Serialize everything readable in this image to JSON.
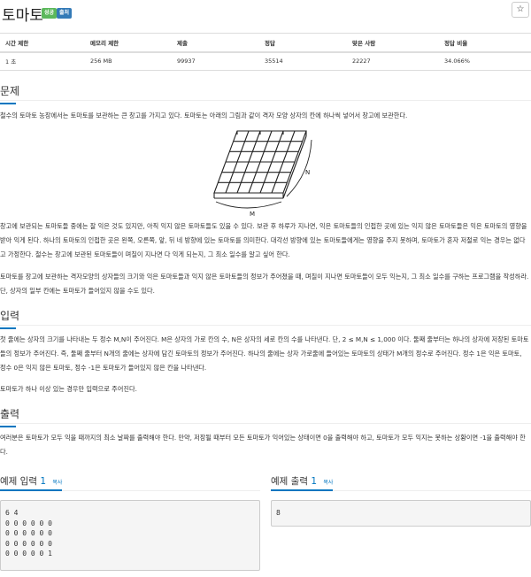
{
  "problem": {
    "title": "토마토",
    "badges": [
      "성공",
      "출처"
    ]
  },
  "header": {
    "star_icon": "star-icon"
  },
  "info_table": {
    "headers": [
      "시간 제한",
      "메모리 제한",
      "제출",
      "정답",
      "맞은 사람",
      "정답 비율"
    ],
    "row": [
      "1 초",
      "256 MB",
      "99937",
      "35514",
      "22227",
      "34.066%"
    ]
  },
  "sections": {
    "problem": {
      "title": "문제",
      "intro": "철수의 토마토 농장에서는 토마토를 보관하는 큰 창고를 가지고 있다. 토마토는 아래의 그림과 같이 격자 모양 상자의 칸에 하나씩 넣어서 창고에 보관한다.",
      "figure_labels": {
        "n": "N",
        "m": "M"
      },
      "body1": "창고에 보관되는 토마토들 중에는 잘 익은 것도 있지만, 아직 익지 않은 토마토들도 있을 수 있다. 보관 후 하루가 지나면, 익은 토마토들의 인접한 곳에 있는 익지 않은 토마토들은 익은 토마토의 영향을 받아 익게 된다. 하나의 토마토의 인접한 곳은 왼쪽, 오른쪽, 앞, 뒤 네 방향에 있는 토마토를 의미한다. 대각선 방향에 있는 토마토들에게는 영향을 주지 못하며, 토마토가 혼자 저절로 익는 경우는 없다고 가정한다. 철수는 창고에 보관된 토마토들이 며칠이 지나면 다 익게 되는지, 그 최소 일수를 알고 싶어 한다.",
      "body2": "토마토를 창고에 보관하는 격자모양의 상자들의 크기와 익은 토마토들과 익지 않은 토마토들의 정보가 주어졌을 때, 며칠이 지나면 토마토들이 모두 익는지, 그 최소 일수를 구하는 프로그램을 작성하라. 단, 상자의 일부 칸에는 토마토가 들어있지 않을 수도 있다."
    },
    "input": {
      "title": "입력",
      "body1": "첫 줄에는 상자의 크기를 나타내는 두 정수 M,N이 주어진다. M은 상자의 가로 칸의 수, N은 상자의 세로 칸의 수를 나타낸다. 단, 2 ≤ M,N ≤ 1,000 이다. 둘째 줄부터는 하나의 상자에 저장된 토마토들의 정보가 주어진다. 즉, 둘째 줄부터 N개의 줄에는 상자에 담긴 토마토의 정보가 주어진다. 하나의 줄에는 상자 가로줄에 들어있는 토마토의 상태가 M개의 정수로 주어진다. 정수 1은 익은 토마토, 정수 0은 익지 않은 토마토, 정수 -1은 토마토가 들어있지 않은 칸을 나타낸다.",
      "body2": "토마토가 하나 이상 있는 경우만 입력으로 주어진다."
    },
    "output": {
      "title": "출력",
      "body": "여러분은 토마토가 모두 익을 때까지의 최소 날짜를 출력해야 한다. 만약, 저장될 때부터 모든 토마토가 익어있는 상태이면 0을 출력해야 하고, 토마토가 모두 익지는 못하는 상황이면 -1을 출력해야 한다."
    }
  },
  "samples": {
    "input": {
      "title": "예제 입력",
      "num": "1",
      "copy": "복사",
      "content": "6 4\n0 0 0 0 0 0\n0 0 0 0 0 0\n0 0 0 0 0 0\n0 0 0 0 0 1"
    },
    "output": {
      "title": "예제 출력",
      "num": "1",
      "copy": "복사",
      "content": "8"
    }
  },
  "colors": {
    "accent": "#0076c0",
    "success": "#5cb85c",
    "primary": "#337ab7"
  }
}
